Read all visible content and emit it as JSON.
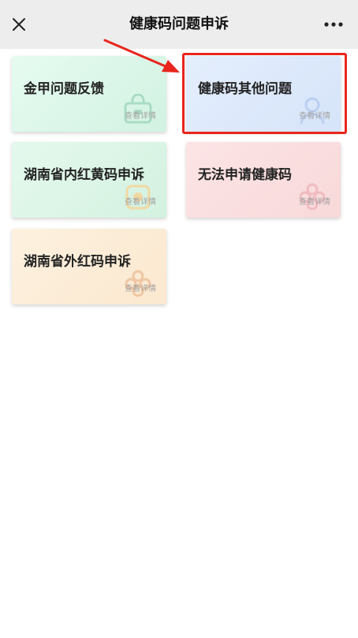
{
  "header": {
    "title": "健康码问题申诉"
  },
  "icons": {
    "close": "close-icon",
    "more": "more-dots-icon"
  },
  "colors": {
    "nav_bg": "#ededed",
    "card_green": "#dff8ec",
    "card_blue": "#dde9fb",
    "card_red": "#fbe0e1",
    "card_orange": "#fdefdb",
    "annotation_red": "#e8261d"
  },
  "cards": [
    {
      "title": "金甲问题反馈",
      "detail": "查看详情"
    },
    {
      "title": "健康码其他问题",
      "detail": "查看详情"
    },
    {
      "title": "湖南省内红黄码申诉",
      "detail": "查看详情"
    },
    {
      "title": "无法申请健康码",
      "detail": "查看详情"
    },
    {
      "title": "湖南省外红码申诉",
      "detail": "查看详情"
    }
  ]
}
